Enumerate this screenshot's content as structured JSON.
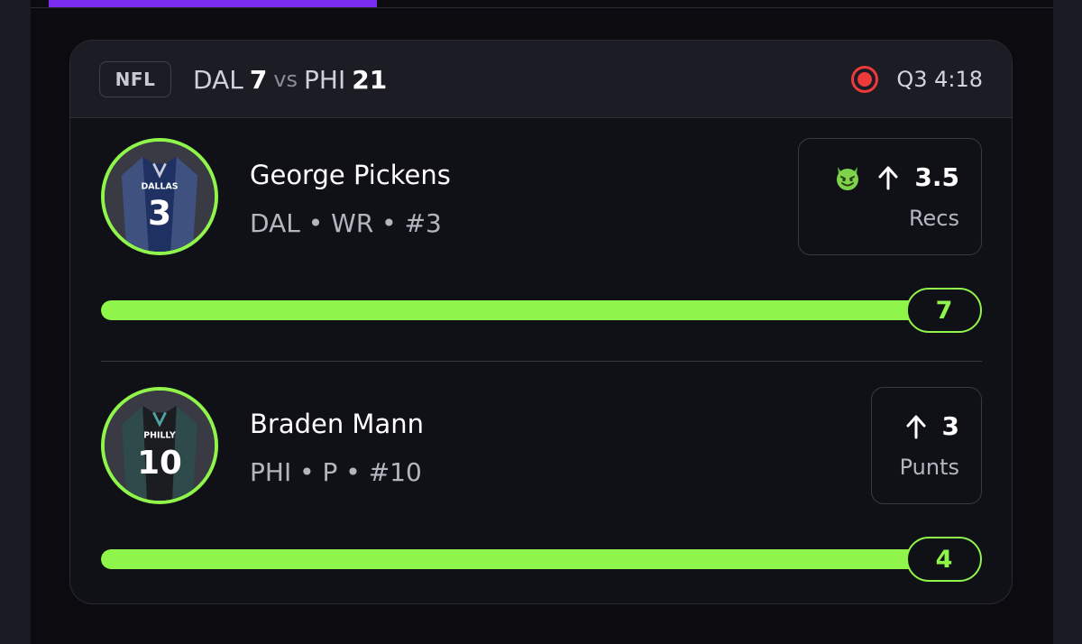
{
  "colors": {
    "accent_green": "#8ff54a",
    "live_red": "#ee3a3a",
    "brand_purple": "#7a2bf0",
    "card_bg": "#101017",
    "header_bg": "#1c1c24"
  },
  "game": {
    "league": "NFL",
    "away_team": "DAL",
    "away_score": "7",
    "vs": "vs",
    "home_team": "PHI",
    "home_score": "21",
    "live_icon": "live-record-icon",
    "clock": "Q3 4:18"
  },
  "players": [
    {
      "name": "George Pickens",
      "team": "DAL",
      "position": "WR",
      "number": "#3",
      "meta": "DAL • WR • #3",
      "jersey": {
        "team_text": "DALLAS",
        "number": "3",
        "color": "#1f3163"
      },
      "line": {
        "icon": "devil-emoji-icon",
        "direction_icon": "arrow-up-icon",
        "value": "3.5",
        "stat": "Recs"
      },
      "progress": {
        "current": "7",
        "fill_fraction": 1.0
      }
    },
    {
      "name": "Braden Mann",
      "team": "PHI",
      "position": "P",
      "number": "#10",
      "meta": "PHI • P • #10",
      "jersey": {
        "team_text": "PHILLY",
        "number": "10",
        "color": "#1b1d20"
      },
      "line": {
        "direction_icon": "arrow-up-icon",
        "value": "3",
        "stat": "Punts"
      },
      "progress": {
        "current": "4",
        "fill_fraction": 1.0
      }
    }
  ]
}
